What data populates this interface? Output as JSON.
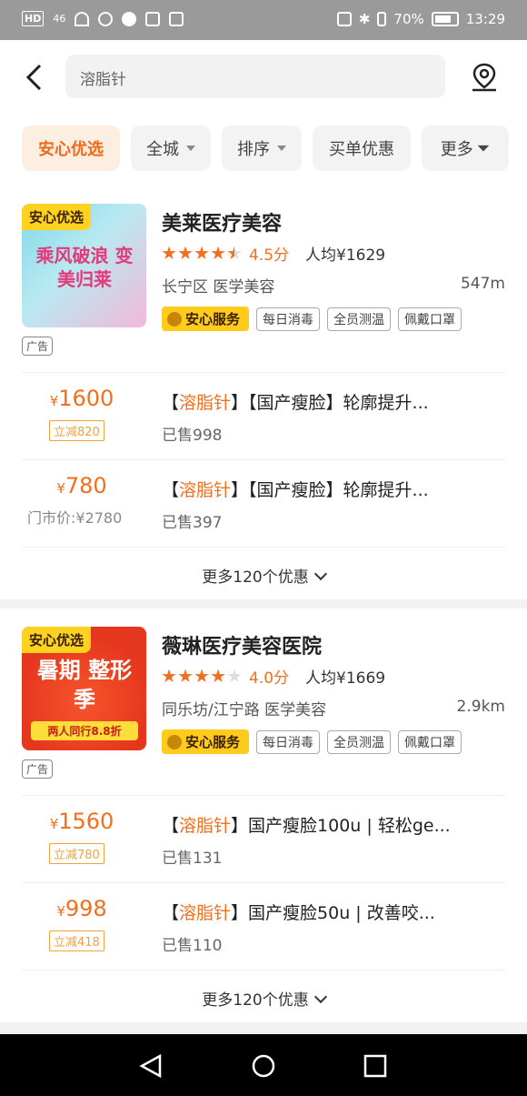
{
  "status": {
    "network": "46",
    "battery": "70%",
    "time": "13:29"
  },
  "search": {
    "query": "溶脂针"
  },
  "filters": [
    "安心优选",
    "全城",
    "排序",
    "买单优惠",
    "更多"
  ],
  "shops": [
    {
      "tag": "安心优选",
      "ad": "广告",
      "name": "美莱医疗美容",
      "rating": 4.5,
      "score": "4.5分",
      "avg": "人均¥1629",
      "area": "长宁区  医学美容",
      "distance": "547m",
      "service": "安心服务",
      "badges": [
        "每日消毒",
        "全员测温",
        "佩戴口罩"
      ],
      "thumb_text": "乘风破浪 变美归莱",
      "deals": [
        {
          "price_symbol": "¥",
          "price": "1600",
          "discount": "立减820",
          "hl": "溶脂针",
          "title_pre": "【",
          "title_post": "】【国产瘦脸】轮廓提升...",
          "sold": "已售998"
        },
        {
          "price_symbol": "¥",
          "price": "780",
          "orig": "门市价:¥2780",
          "hl": "溶脂针",
          "title_pre": "【",
          "title_post": "】【国产瘦脸】轮廓提升...",
          "sold": "已售397"
        }
      ],
      "more": "更多120个优惠"
    },
    {
      "tag": "安心优选",
      "ad": "广告",
      "name": "薇琳医疗美容医院",
      "rating": 4.0,
      "score": "4.0分",
      "avg": "人均¥1669",
      "area": "同乐坊/江宁路  医学美容",
      "distance": "2.9km",
      "service": "安心服务",
      "badges": [
        "每日消毒",
        "全员测温",
        "佩戴口罩"
      ],
      "thumb_text": "暑期 整形季",
      "thumb_sub": "两人同行8.8折",
      "deals": [
        {
          "price_symbol": "¥",
          "price": "1560",
          "discount": "立减780",
          "hl": "溶脂针",
          "title_pre": "【",
          "title_post": "】国产瘦脸100u | 轻松ge...",
          "sold": "已售131"
        },
        {
          "price_symbol": "¥",
          "price": "998",
          "discount": "立减418",
          "hl": "溶脂针",
          "title_pre": "【",
          "title_post": "】国产瘦脸50u | 改善咬...",
          "sold": "已售110"
        }
      ],
      "more": "更多120个优惠"
    }
  ],
  "colors": {
    "accent": "#f26f1e",
    "badge": "#ffd21f",
    "status_bar": "#9a9a9a"
  }
}
